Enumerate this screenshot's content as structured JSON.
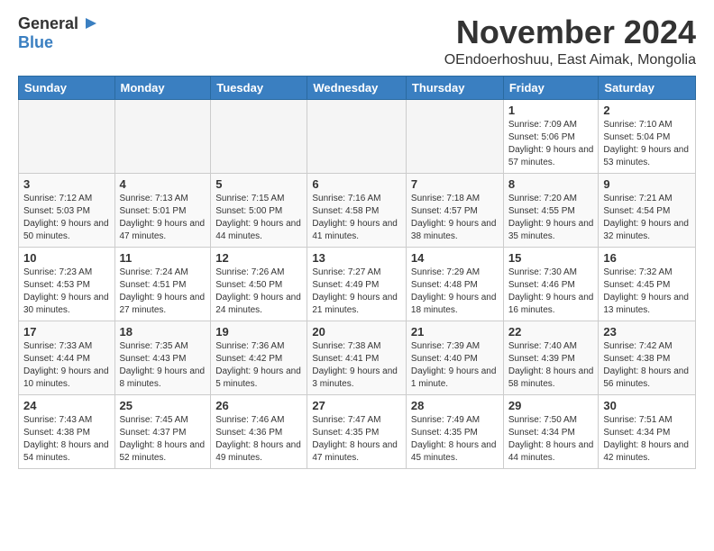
{
  "header": {
    "logo_general": "General",
    "logo_blue": "Blue",
    "month": "November 2024",
    "location": "OEndoerhoshuu, East Aimak, Mongolia"
  },
  "weekdays": [
    "Sunday",
    "Monday",
    "Tuesday",
    "Wednesday",
    "Thursday",
    "Friday",
    "Saturday"
  ],
  "weeks": [
    [
      {
        "day": "",
        "info": ""
      },
      {
        "day": "",
        "info": ""
      },
      {
        "day": "",
        "info": ""
      },
      {
        "day": "",
        "info": ""
      },
      {
        "day": "",
        "info": ""
      },
      {
        "day": "1",
        "info": "Sunrise: 7:09 AM\nSunset: 5:06 PM\nDaylight: 9 hours and 57 minutes."
      },
      {
        "day": "2",
        "info": "Sunrise: 7:10 AM\nSunset: 5:04 PM\nDaylight: 9 hours and 53 minutes."
      }
    ],
    [
      {
        "day": "3",
        "info": "Sunrise: 7:12 AM\nSunset: 5:03 PM\nDaylight: 9 hours and 50 minutes."
      },
      {
        "day": "4",
        "info": "Sunrise: 7:13 AM\nSunset: 5:01 PM\nDaylight: 9 hours and 47 minutes."
      },
      {
        "day": "5",
        "info": "Sunrise: 7:15 AM\nSunset: 5:00 PM\nDaylight: 9 hours and 44 minutes."
      },
      {
        "day": "6",
        "info": "Sunrise: 7:16 AM\nSunset: 4:58 PM\nDaylight: 9 hours and 41 minutes."
      },
      {
        "day": "7",
        "info": "Sunrise: 7:18 AM\nSunset: 4:57 PM\nDaylight: 9 hours and 38 minutes."
      },
      {
        "day": "8",
        "info": "Sunrise: 7:20 AM\nSunset: 4:55 PM\nDaylight: 9 hours and 35 minutes."
      },
      {
        "day": "9",
        "info": "Sunrise: 7:21 AM\nSunset: 4:54 PM\nDaylight: 9 hours and 32 minutes."
      }
    ],
    [
      {
        "day": "10",
        "info": "Sunrise: 7:23 AM\nSunset: 4:53 PM\nDaylight: 9 hours and 30 minutes."
      },
      {
        "day": "11",
        "info": "Sunrise: 7:24 AM\nSunset: 4:51 PM\nDaylight: 9 hours and 27 minutes."
      },
      {
        "day": "12",
        "info": "Sunrise: 7:26 AM\nSunset: 4:50 PM\nDaylight: 9 hours and 24 minutes."
      },
      {
        "day": "13",
        "info": "Sunrise: 7:27 AM\nSunset: 4:49 PM\nDaylight: 9 hours and 21 minutes."
      },
      {
        "day": "14",
        "info": "Sunrise: 7:29 AM\nSunset: 4:48 PM\nDaylight: 9 hours and 18 minutes."
      },
      {
        "day": "15",
        "info": "Sunrise: 7:30 AM\nSunset: 4:46 PM\nDaylight: 9 hours and 16 minutes."
      },
      {
        "day": "16",
        "info": "Sunrise: 7:32 AM\nSunset: 4:45 PM\nDaylight: 9 hours and 13 minutes."
      }
    ],
    [
      {
        "day": "17",
        "info": "Sunrise: 7:33 AM\nSunset: 4:44 PM\nDaylight: 9 hours and 10 minutes."
      },
      {
        "day": "18",
        "info": "Sunrise: 7:35 AM\nSunset: 4:43 PM\nDaylight: 9 hours and 8 minutes."
      },
      {
        "day": "19",
        "info": "Sunrise: 7:36 AM\nSunset: 4:42 PM\nDaylight: 9 hours and 5 minutes."
      },
      {
        "day": "20",
        "info": "Sunrise: 7:38 AM\nSunset: 4:41 PM\nDaylight: 9 hours and 3 minutes."
      },
      {
        "day": "21",
        "info": "Sunrise: 7:39 AM\nSunset: 4:40 PM\nDaylight: 9 hours and 1 minute."
      },
      {
        "day": "22",
        "info": "Sunrise: 7:40 AM\nSunset: 4:39 PM\nDaylight: 8 hours and 58 minutes."
      },
      {
        "day": "23",
        "info": "Sunrise: 7:42 AM\nSunset: 4:38 PM\nDaylight: 8 hours and 56 minutes."
      }
    ],
    [
      {
        "day": "24",
        "info": "Sunrise: 7:43 AM\nSunset: 4:38 PM\nDaylight: 8 hours and 54 minutes."
      },
      {
        "day": "25",
        "info": "Sunrise: 7:45 AM\nSunset: 4:37 PM\nDaylight: 8 hours and 52 minutes."
      },
      {
        "day": "26",
        "info": "Sunrise: 7:46 AM\nSunset: 4:36 PM\nDaylight: 8 hours and 49 minutes."
      },
      {
        "day": "27",
        "info": "Sunrise: 7:47 AM\nSunset: 4:35 PM\nDaylight: 8 hours and 47 minutes."
      },
      {
        "day": "28",
        "info": "Sunrise: 7:49 AM\nSunset: 4:35 PM\nDaylight: 8 hours and 45 minutes."
      },
      {
        "day": "29",
        "info": "Sunrise: 7:50 AM\nSunset: 4:34 PM\nDaylight: 8 hours and 44 minutes."
      },
      {
        "day": "30",
        "info": "Sunrise: 7:51 AM\nSunset: 4:34 PM\nDaylight: 8 hours and 42 minutes."
      }
    ]
  ]
}
